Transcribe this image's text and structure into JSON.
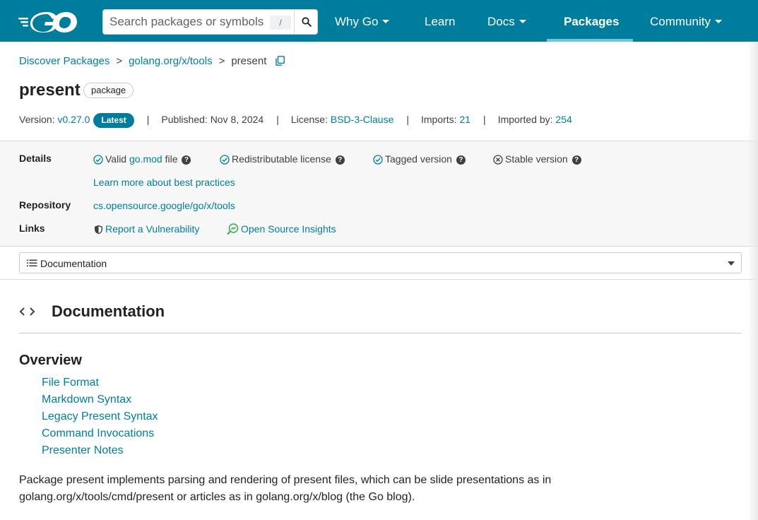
{
  "header": {
    "search_placeholder": "Search packages or symbols",
    "search_shortcut": "/",
    "nav": [
      {
        "label": "Why Go",
        "dropdown": true
      },
      {
        "label": "Learn",
        "dropdown": false
      },
      {
        "label": "Docs",
        "dropdown": true
      },
      {
        "label": "Packages",
        "dropdown": false,
        "active": true
      },
      {
        "label": "Community",
        "dropdown": true
      }
    ]
  },
  "breadcrumb": {
    "items": [
      "Discover Packages",
      "golang.org/x/tools",
      "present"
    ],
    "separator": ">"
  },
  "package": {
    "name": "present",
    "kind_badge": "package"
  },
  "meta": {
    "version_label": "Version:",
    "version": "v0.27.0",
    "latest_badge": "Latest",
    "published_label": "Published:",
    "published": "Nov 8, 2024",
    "license_label": "License:",
    "license": "BSD-3-Clause",
    "imports_label": "Imports:",
    "imports": "21",
    "imported_by_label": "Imported by:",
    "imported_by": "254",
    "pipe": "|"
  },
  "details": {
    "details_label": "Details",
    "checks": [
      {
        "prefix": "Valid ",
        "link": "go.mod",
        "suffix": " file",
        "status": "ok"
      },
      {
        "prefix": "Redistributable license",
        "link": "",
        "suffix": "",
        "status": "ok"
      },
      {
        "prefix": "Tagged version",
        "link": "",
        "suffix": "",
        "status": "ok"
      },
      {
        "prefix": "Stable version",
        "link": "",
        "suffix": "",
        "status": "fail"
      }
    ],
    "help_glyph": "?",
    "best_practices_link": "Learn more about best practices",
    "repository_label": "Repository",
    "repository": "cs.opensource.google/go/x/tools",
    "links_label": "Links",
    "report_vuln": "Report a Vulnerability",
    "open_source_insights": "Open Source Insights"
  },
  "outline_select": {
    "value": "Documentation"
  },
  "documentation": {
    "heading": "Documentation",
    "overview_heading": "Overview",
    "toc": [
      "File Format",
      "Markdown Syntax",
      "Legacy Present Syntax",
      "Command Invocations",
      "Presenter Notes"
    ],
    "paragraph": "Package present implements parsing and rendering of present files, which can be slide presentations as in golang.org/x/tools/cmd/present or articles as in golang.org/x/blog (the Go blog)."
  },
  "colors": {
    "brand": "#007d9c",
    "panel_bg": "#f7f7f8",
    "text": "#202224"
  }
}
